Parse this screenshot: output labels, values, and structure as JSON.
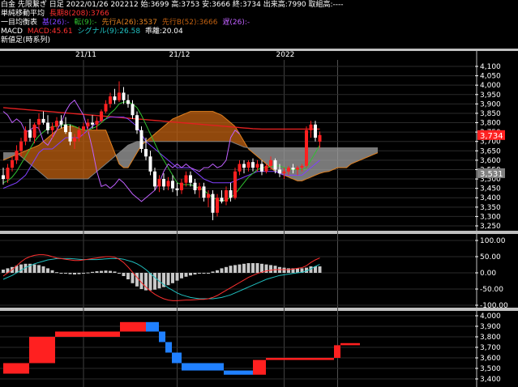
{
  "header": {
    "line1": "白金 先限繋ぎ 日足 2022/01/26 202212 始:3699 高:3753 安:3666 終:3734 出来高:7990 取組高:----",
    "ma_label": "単純移動平均",
    "ma_value": "長期8(208):3766",
    "ichimoku_label": "一目均衡表",
    "ichimoku_kijun": "基(26):-",
    "ichimoku_tenkan": "転(9):-",
    "ichimoku_senkou_a": "先行A(26):3537",
    "ichimoku_senkou_b": "先行B(52):3666",
    "ichimoku_chikou": "遅(26):-",
    "macd_label": "MACD",
    "macd_value": "MACD:45.61",
    "signal_value": "シグナル(9):26.58",
    "hist_value": "乖離:20.04",
    "new_value_label": "新値足(時系列)"
  },
  "colors": {
    "up": "#ff2020",
    "down": "#2080ff",
    "ma": "#e02020",
    "tenkan": "#30c030",
    "kijun": "#8040ff",
    "chikou": "#c060ff",
    "cloud_bull": "#a0a0a0",
    "cloud_bear": "#c06010",
    "macd": "#ff3030",
    "signal": "#20c0c0",
    "hist": "#c8c8c8",
    "current_price_bg": "#ff2020",
    "gray_price_bg": "#808080"
  },
  "x_dates": [
    "21/11",
    "21/12",
    "2022"
  ],
  "price_panel": {
    "y_ticks": [
      "4,100",
      "4,050",
      "4,000",
      "3,950",
      "3,900",
      "3,850",
      "3,800",
      "3,750",
      "3,700",
      "3,650",
      "3,600",
      "3,550",
      "3,500",
      "3,450",
      "3,400",
      "3,350",
      "3,300",
      "3,250"
    ],
    "current_price": "3,734",
    "gray_price": "3,531"
  },
  "macd_panel": {
    "y_ticks": [
      "100.00",
      "50.00",
      "0.00",
      "-50.00",
      "-100.00"
    ]
  },
  "newval_panel": {
    "y_ticks": [
      "4,000",
      "3,900",
      "3,800",
      "3,700",
      "3,600",
      "3,500",
      "3,400"
    ]
  },
  "chart_data": {
    "type": "candlestick",
    "note_series": [
      "ohlc",
      "ma208",
      "tenkan",
      "kijun",
      "senkou_a",
      "senkou_b",
      "chikou",
      "macd",
      "signal",
      "histogram",
      "new_value_bricks"
    ],
    "candles": [
      [
        3520,
        3560,
        3470,
        3500
      ],
      [
        3500,
        3580,
        3480,
        3560
      ],
      [
        3560,
        3620,
        3540,
        3600
      ],
      [
        3600,
        3680,
        3580,
        3650
      ],
      [
        3650,
        3720,
        3620,
        3700
      ],
      [
        3700,
        3780,
        3680,
        3760
      ],
      [
        3760,
        3820,
        3700,
        3720
      ],
      [
        3720,
        3800,
        3690,
        3790
      ],
      [
        3790,
        3850,
        3760,
        3820
      ],
      [
        3820,
        3860,
        3790,
        3800
      ],
      [
        3800,
        3840,
        3740,
        3760
      ],
      [
        3760,
        3800,
        3720,
        3780
      ],
      [
        3780,
        3830,
        3760,
        3810
      ],
      [
        3810,
        3840,
        3770,
        3790
      ],
      [
        3790,
        3830,
        3740,
        3750
      ],
      [
        3750,
        3790,
        3680,
        3700
      ],
      [
        3700,
        3740,
        3660,
        3720
      ],
      [
        3720,
        3780,
        3700,
        3760
      ],
      [
        3760,
        3800,
        3730,
        3780
      ],
      [
        3780,
        3820,
        3750,
        3800
      ],
      [
        3800,
        3840,
        3770,
        3790
      ],
      [
        3790,
        3830,
        3760,
        3810
      ],
      [
        3810,
        3870,
        3800,
        3860
      ],
      [
        3860,
        3920,
        3850,
        3900
      ],
      [
        3900,
        3960,
        3880,
        3940
      ],
      [
        3940,
        3980,
        3900,
        3920
      ],
      [
        3920,
        4020,
        3910,
        3960
      ],
      [
        3960,
        3990,
        3900,
        3920
      ],
      [
        3920,
        3950,
        3880,
        3900
      ],
      [
        3900,
        3920,
        3820,
        3840
      ],
      [
        3840,
        3860,
        3740,
        3760
      ],
      [
        3760,
        3780,
        3640,
        3660
      ],
      [
        3660,
        3720,
        3600,
        3620
      ],
      [
        3620,
        3650,
        3520,
        3540
      ],
      [
        3540,
        3560,
        3440,
        3460
      ],
      [
        3460,
        3520,
        3430,
        3500
      ],
      [
        3500,
        3530,
        3440,
        3460
      ],
      [
        3460,
        3510,
        3440,
        3490
      ],
      [
        3490,
        3520,
        3430,
        3450
      ],
      [
        3450,
        3480,
        3410,
        3440
      ],
      [
        3440,
        3500,
        3420,
        3480
      ],
      [
        3480,
        3540,
        3460,
        3520
      ],
      [
        3520,
        3540,
        3460,
        3480
      ],
      [
        3480,
        3500,
        3420,
        3440
      ],
      [
        3440,
        3480,
        3400,
        3460
      ],
      [
        3460,
        3480,
        3380,
        3400
      ],
      [
        3400,
        3440,
        3350,
        3420
      ],
      [
        3420,
        3440,
        3280,
        3320
      ],
      [
        3320,
        3420,
        3300,
        3400
      ],
      [
        3400,
        3440,
        3370,
        3380
      ],
      [
        3380,
        3460,
        3360,
        3440
      ],
      [
        3440,
        3480,
        3380,
        3400
      ],
      [
        3400,
        3560,
        3390,
        3540
      ],
      [
        3540,
        3600,
        3520,
        3580
      ],
      [
        3580,
        3600,
        3530,
        3560
      ],
      [
        3560,
        3600,
        3540,
        3590
      ],
      [
        3590,
        3610,
        3540,
        3560
      ],
      [
        3560,
        3600,
        3540,
        3580
      ],
      [
        3580,
        3600,
        3520,
        3540
      ],
      [
        3540,
        3580,
        3530,
        3570
      ],
      [
        3570,
        3620,
        3550,
        3600
      ],
      [
        3600,
        3610,
        3530,
        3550
      ],
      [
        3550,
        3580,
        3510,
        3530
      ],
      [
        3530,
        3560,
        3500,
        3540
      ],
      [
        3540,
        3570,
        3520,
        3560
      ],
      [
        3560,
        3580,
        3530,
        3550
      ],
      [
        3550,
        3570,
        3520,
        3560
      ],
      [
        3560,
        3580,
        3540,
        3570
      ],
      [
        3570,
        3780,
        3560,
        3760
      ],
      [
        3760,
        3810,
        3720,
        3790
      ],
      [
        3790,
        3810,
        3700,
        3720
      ],
      [
        3699,
        3753,
        3666,
        3734
      ]
    ],
    "ma208": [
      3880,
      3878,
      3876,
      3874,
      3872,
      3870,
      3868,
      3866,
      3864,
      3862,
      3860,
      3858,
      3856,
      3854,
      3852,
      3850,
      3848,
      3846,
      3844,
      3842,
      3840,
      3838,
      3836,
      3834,
      3832,
      3830,
      3828,
      3826,
      3824,
      3822,
      3820,
      3818,
      3816,
      3814,
      3812,
      3810,
      3808,
      3806,
      3804,
      3802,
      3800,
      3798,
      3796,
      3794,
      3792,
      3790,
      3788,
      3786,
      3784,
      3782,
      3780,
      3778,
      3776,
      3774,
      3772,
      3770,
      3768,
      3767,
      3766,
      3766,
      3766,
      3766,
      3766,
      3766,
      3766,
      3766,
      3766,
      3766,
      3766,
      3766,
      3766,
      3766
    ],
    "tenkan": [
      3480,
      3490,
      3510,
      3540,
      3580,
      3620,
      3660,
      3700,
      3730,
      3750,
      3770,
      3780,
      3780,
      3785,
      3790,
      3790,
      3780,
      3770,
      3760,
      3760,
      3770,
      3780,
      3800,
      3820,
      3850,
      3870,
      3900,
      3910,
      3910,
      3900,
      3880,
      3840,
      3790,
      3740,
      3690,
      3640,
      3600,
      3560,
      3520,
      3480,
      3470,
      3470,
      3470,
      3460,
      3450,
      3440,
      3420,
      3400,
      3390,
      3380,
      3390,
      3400,
      3420,
      3450,
      3480,
      3510,
      3530,
      3550,
      3560,
      3560,
      3565,
      3570,
      3570,
      3560,
      3555,
      3550,
      3550,
      3550,
      3560,
      3600,
      3640,
      3680
    ],
    "kijun": [
      3450,
      3460,
      3470,
      3480,
      3500,
      3520,
      3560,
      3600,
      3640,
      3660,
      3660,
      3660,
      3680,
      3700,
      3720,
      3720,
      3720,
      3720,
      3740,
      3760,
      3780,
      3800,
      3810,
      3820,
      3830,
      3830,
      3830,
      3830,
      3820,
      3800,
      3780,
      3740,
      3700,
      3680,
      3660,
      3640,
      3620,
      3600,
      3580,
      3560,
      3560,
      3560,
      3560,
      3540,
      3520,
      3500,
      3490,
      3480,
      3480,
      3480,
      3480,
      3480,
      3490,
      3500,
      3510,
      3520,
      3530,
      3540,
      3540,
      3540,
      3540,
      3540,
      3530,
      3520,
      3520,
      3520,
      3520,
      3520,
      3540,
      3560,
      3580,
      3600
    ],
    "senkou_a": [
      3600,
      3610,
      3620,
      3630,
      3640,
      3650,
      3660,
      3670,
      3680,
      3700,
      3720,
      3740,
      3760,
      3770,
      3780,
      3780,
      3780,
      3770,
      3760,
      3760,
      3760,
      3760,
      3760,
      3760,
      3700,
      3640,
      3580,
      3560,
      3560,
      3600,
      3640,
      3680,
      3700,
      3720,
      3740,
      3760,
      3780,
      3800,
      3820,
      3830,
      3840,
      3850,
      3860,
      3860,
      3860,
      3860,
      3860,
      3860,
      3850,
      3840,
      3820,
      3800,
      3780,
      3740,
      3700,
      3660,
      3640,
      3620,
      3600,
      3580,
      3560,
      3540,
      3530,
      3520,
      3510,
      3500,
      3490,
      3490,
      3500,
      3510,
      3520,
      3530,
      3537,
      3540,
      3550,
      3560,
      3560,
      3560,
      3580,
      3590,
      3600,
      3610,
      3620,
      3630,
      3640
    ],
    "senkou_b": [
      3640,
      3640,
      3640,
      3640,
      3620,
      3600,
      3580,
      3560,
      3540,
      3520,
      3500,
      3500,
      3500,
      3500,
      3500,
      3500,
      3500,
      3500,
      3500,
      3500,
      3520,
      3540,
      3560,
      3580,
      3600,
      3620,
      3640,
      3660,
      3680,
      3690,
      3700,
      3700,
      3700,
      3700,
      3700,
      3700,
      3700,
      3700,
      3700,
      3700,
      3700,
      3700,
      3700,
      3700,
      3700,
      3700,
      3700,
      3700,
      3700,
      3700,
      3700,
      3700,
      3690,
      3680,
      3670,
      3666,
      3666,
      3666,
      3666,
      3666,
      3666,
      3666,
      3666,
      3666,
      3666,
      3666,
      3666,
      3666,
      3666,
      3666,
      3666,
      3666,
      3666,
      3666,
      3666,
      3666,
      3666,
      3666,
      3666,
      3666,
      3666,
      3666,
      3666,
      3666,
      3666
    ],
    "chikou": [
      3860,
      3840,
      3800,
      3820,
      3800,
      3750,
      3760,
      3780,
      3770,
      3700,
      3680,
      3720,
      3760,
      3800,
      3860,
      3900,
      3920,
      3880,
      3840,
      3760,
      3660,
      3540,
      3460,
      3470,
      3450,
      3470,
      3500,
      3480,
      3450,
      3420,
      3400,
      3380,
      3400,
      3420,
      3440,
      3480,
      3540,
      3580,
      3560,
      3580,
      3560,
      3580,
      3560,
      3550,
      3540,
      3560,
      3560,
      3580,
      3560,
      3570,
      3600,
      3720,
      3760,
      3740
    ],
    "macd": [
      -10,
      0,
      10,
      22,
      34,
      44,
      50,
      54,
      56,
      56,
      54,
      50,
      46,
      44,
      42,
      40,
      38,
      38,
      40,
      42,
      44,
      46,
      48,
      50,
      50,
      48,
      42,
      32,
      18,
      2,
      -14,
      -30,
      -44,
      -56,
      -66,
      -74,
      -80,
      -84,
      -86,
      -86,
      -85,
      -84,
      -84,
      -83,
      -82,
      -82,
      -80,
      -76,
      -70,
      -62,
      -54,
      -46,
      -38,
      -30,
      -22,
      -14,
      -8,
      -2,
      2,
      6,
      8,
      10,
      10,
      10,
      10,
      12,
      14,
      16,
      22,
      32,
      40,
      46
    ],
    "signal": [
      -20,
      -14,
      -8,
      0,
      8,
      16,
      22,
      28,
      32,
      36,
      40,
      42,
      44,
      44,
      44,
      44,
      43,
      42,
      41,
      41,
      41,
      41,
      42,
      43,
      44,
      44,
      44,
      42,
      38,
      34,
      28,
      20,
      10,
      -2,
      -14,
      -26,
      -36,
      -46,
      -54,
      -62,
      -68,
      -72,
      -76,
      -78,
      -80,
      -80,
      -80,
      -80,
      -78,
      -76,
      -72,
      -68,
      -62,
      -56,
      -50,
      -44,
      -38,
      -32,
      -26,
      -20,
      -16,
      -12,
      -8,
      -6,
      -4,
      -2,
      0,
      2,
      6,
      12,
      20,
      26
    ],
    "hist": [
      10,
      14,
      18,
      22,
      26,
      28,
      28,
      26,
      24,
      20,
      14,
      8,
      2,
      0,
      -2,
      -4,
      -5,
      -4,
      -1,
      1,
      3,
      5,
      6,
      7,
      6,
      4,
      -2,
      -10,
      -20,
      -32,
      -42,
      -50,
      -54,
      -54,
      -52,
      -48,
      -44,
      -38,
      -32,
      -24,
      -17,
      -12,
      -8,
      -5,
      -2,
      -2,
      0,
      4,
      8,
      14,
      18,
      22,
      24,
      26,
      28,
      30,
      30,
      30,
      28,
      26,
      24,
      22,
      18,
      16,
      14,
      14,
      14,
      14,
      16,
      20,
      20,
      20
    ],
    "new_value_bricks": [
      {
        "dir": "up",
        "from": 3450,
        "to": 3550,
        "start": 0,
        "end": 8
      },
      {
        "dir": "up",
        "from": 3550,
        "to": 3800,
        "start": 8,
        "end": 16
      },
      {
        "dir": "up",
        "from": 3800,
        "to": 3850,
        "start": 16,
        "end": 36
      },
      {
        "dir": "up",
        "from": 3850,
        "to": 3940,
        "start": 36,
        "end": 44
      },
      {
        "dir": "down",
        "from": 3940,
        "to": 3850,
        "start": 44,
        "end": 48
      },
      {
        "dir": "down",
        "from": 3850,
        "to": 3750,
        "start": 48,
        "end": 50
      },
      {
        "dir": "down",
        "from": 3750,
        "to": 3650,
        "start": 50,
        "end": 52
      },
      {
        "dir": "down",
        "from": 3650,
        "to": 3550,
        "start": 52,
        "end": 55
      },
      {
        "dir": "down",
        "from": 3550,
        "to": 3480,
        "start": 55,
        "end": 68
      },
      {
        "dir": "down",
        "from": 3480,
        "to": 3440,
        "start": 68,
        "end": 77
      },
      {
        "dir": "up",
        "from": 3440,
        "to": 3580,
        "start": 77,
        "end": 81
      },
      {
        "dir": "up",
        "from": 3580,
        "to": 3600,
        "start": 81,
        "end": 102
      },
      {
        "dir": "up",
        "from": 3600,
        "to": 3720,
        "start": 102,
        "end": 104
      },
      {
        "dir": "up",
        "from": 3720,
        "to": 3740,
        "start": 104,
        "end": 110
      }
    ]
  }
}
